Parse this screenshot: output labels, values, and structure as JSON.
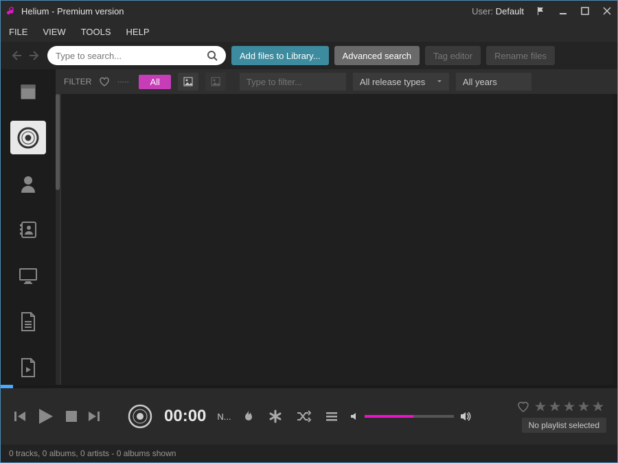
{
  "window": {
    "title": "Helium - Premium version",
    "user_label": "User:",
    "user_name": "Default"
  },
  "menu": {
    "file": "FILE",
    "view": "VIEW",
    "tools": "TOOLS",
    "help": "HELP"
  },
  "toolbar": {
    "search_placeholder": "Type to search...",
    "add_files": "Add files to Library...",
    "advanced_search": "Advanced search",
    "tag_editor": "Tag editor",
    "rename_files": "Rename files"
  },
  "filter": {
    "label": "FILTER",
    "all": "All",
    "filter_placeholder": "Type to filter...",
    "release_types": "All release types",
    "years": "All years"
  },
  "player": {
    "time": "00:00",
    "now_playing": "N...",
    "no_playlist": "No playlist selected"
  },
  "status": {
    "text": "0 tracks, 0 albums, 0 artists - 0 albums shown"
  },
  "colors": {
    "accent_pink": "#e815c8",
    "accent_teal": "#3d8b9e",
    "accent_purple": "#c73db8"
  }
}
